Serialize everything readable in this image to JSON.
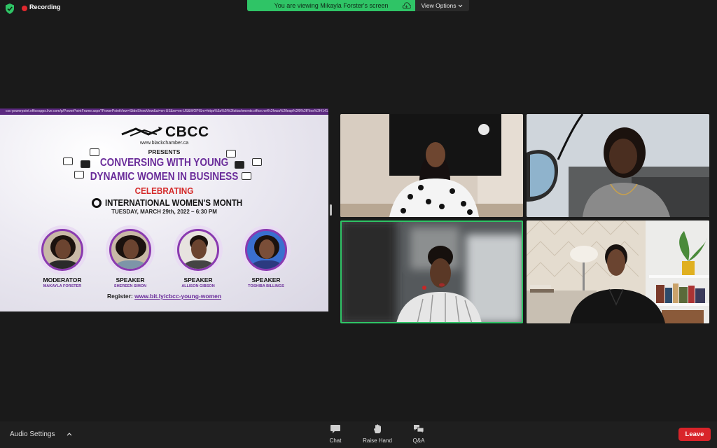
{
  "topbar": {
    "recording_label": "Recording",
    "viewing_text": "You are viewing Mikayla Forster's screen",
    "view_options_label": "View Options"
  },
  "share": {
    "url": "csc-powerpoint.officeapps.live.com/p/PowerPointFrame.aspx?PowerPointView=SlideShowView&ui=en-US&rs=en-US&WOPISrc=https%3a%2f%2fattachments.office.net%2fowa%2fleap%2f0%2fFiles%2f4141...",
    "slide": {
      "org": "CBCC",
      "site": "www.blackchamber.ca",
      "presents": "PRESENTS",
      "title_line1": "CONVERSING WITH YOUNG",
      "title_line2": "DYNAMIC WOMEN IN BUSINESS",
      "celebrating": "CELEBRATING",
      "event": "INTERNATIONAL WOMEN'S MONTH",
      "date": "TUESDAY, MARCH 29th, 2022 – 6:30 PM",
      "people": [
        {
          "role": "MODERATOR",
          "name": "MAKAYLA FORSTER"
        },
        {
          "role": "SPEAKER",
          "name": "SHEREEN SIMON"
        },
        {
          "role": "SPEAKER",
          "name": "ALLISON GIBSON"
        },
        {
          "role": "SPEAKER",
          "name": "TOSHIBA BILLINGS"
        }
      ],
      "register_label": "Register:",
      "register_link": "www.bit.ly/cbcc-young-women"
    }
  },
  "toolbar": {
    "audio_settings": "Audio Settings",
    "chat": "Chat",
    "raise_hand": "Raise Hand",
    "qa": "Q&A",
    "leave": "Leave"
  },
  "colors": {
    "active_speaker": "#2fc466",
    "leave": "#d9242a",
    "slide_purple": "#6a2c9a",
    "slide_red": "#d42a2a"
  }
}
